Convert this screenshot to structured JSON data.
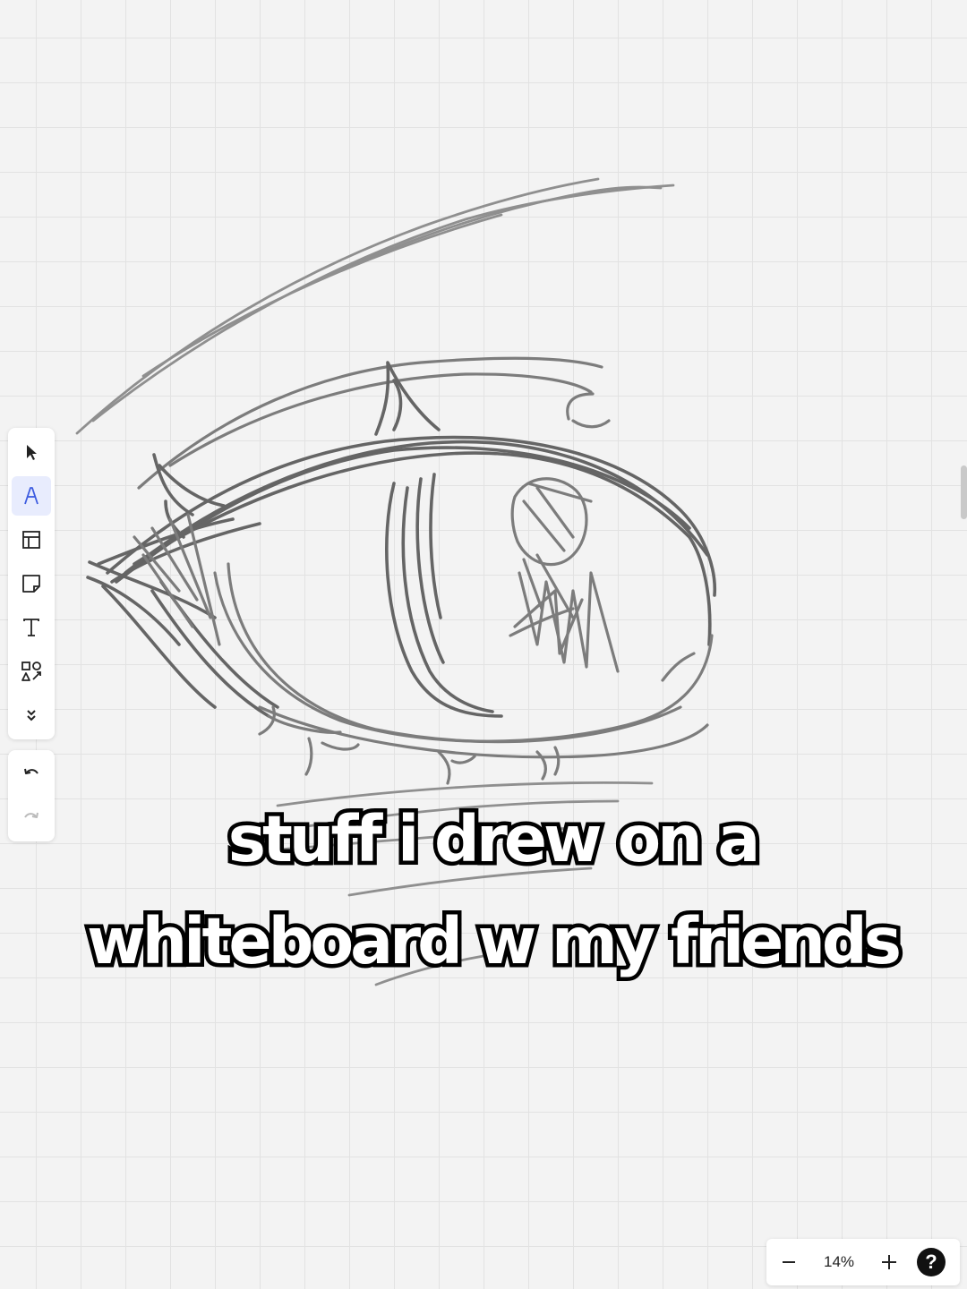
{
  "caption": {
    "line1": "stuff i drew on a",
    "line2": "whiteboard w my friends"
  },
  "toolbar": {
    "tools": [
      {
        "name": "select",
        "icon": "cursor-arrow-icon",
        "active": false
      },
      {
        "name": "pen",
        "icon": "pen-icon",
        "active": true
      },
      {
        "name": "frame",
        "icon": "layout-frame-icon",
        "active": false
      },
      {
        "name": "sticky-note",
        "icon": "sticky-note-icon",
        "active": false
      },
      {
        "name": "text",
        "icon": "text-icon",
        "active": false
      },
      {
        "name": "shapes",
        "icon": "shapes-icon",
        "active": false
      },
      {
        "name": "more",
        "icon": "chevrons-down-icon",
        "active": false
      }
    ],
    "history": [
      {
        "name": "undo",
        "icon": "undo-icon",
        "enabled": true
      },
      {
        "name": "redo",
        "icon": "redo-icon",
        "enabled": false
      }
    ]
  },
  "zoom": {
    "level": "14%",
    "zoom_out_icon": "minus-icon",
    "zoom_in_icon": "plus-icon",
    "help_label": "?"
  },
  "colors": {
    "background": "#f3f3f3",
    "grid": "#e2e2e2",
    "stroke": "#7c7c7c",
    "active_tool": "#e8ecfd"
  }
}
